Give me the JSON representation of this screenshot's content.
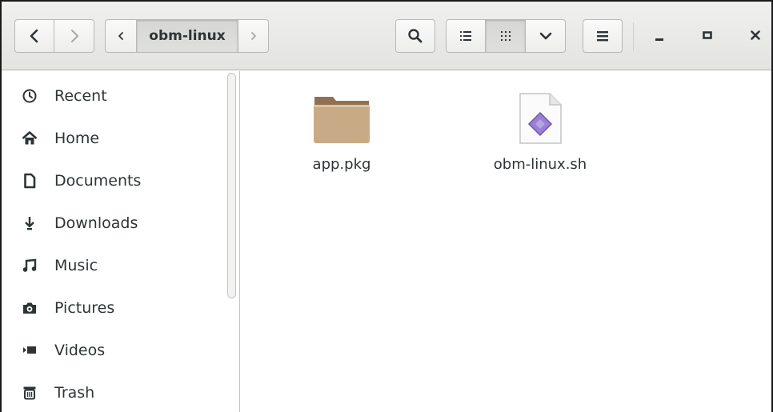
{
  "window": {
    "location": "obm-linux"
  },
  "toolbar": {
    "back": "back",
    "forward": "forward",
    "path_prev": "previous-path",
    "path_next": "next-path",
    "search": "search",
    "list_view": "list-view",
    "grid_view": "grid-view",
    "view_options": "view-options",
    "menu": "menu",
    "minimize": "minimize",
    "maximize": "maximize",
    "close": "close"
  },
  "sidebar": {
    "items": [
      {
        "label": "Recent",
        "icon": "clock-icon"
      },
      {
        "label": "Home",
        "icon": "home-icon"
      },
      {
        "label": "Documents",
        "icon": "document-icon"
      },
      {
        "label": "Downloads",
        "icon": "download-icon"
      },
      {
        "label": "Music",
        "icon": "music-icon"
      },
      {
        "label": "Pictures",
        "icon": "camera-icon"
      },
      {
        "label": "Videos",
        "icon": "video-icon"
      },
      {
        "label": "Trash",
        "icon": "trash-icon"
      }
    ]
  },
  "files": [
    {
      "name": "app.pkg",
      "icon": "folder-icon"
    },
    {
      "name": "obm-linux.sh",
      "icon": "script-file-icon"
    }
  ],
  "colors": {
    "folder": "#c8a883",
    "folder_tab": "#8f7152",
    "script_diamond": "#9b7fd4"
  }
}
